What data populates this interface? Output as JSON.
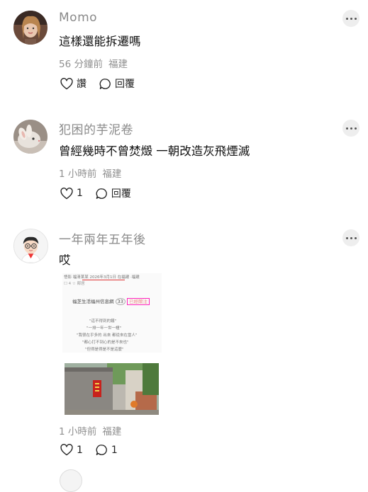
{
  "comments": [
    {
      "name": "Momo",
      "text": "這樣還能拆遷嗎",
      "time": "56 分鐘前",
      "location": "福建",
      "like_label": "讚",
      "reply_label": "回覆"
    },
    {
      "name": "犯困的芋泥卷",
      "text": "曾經幾時不曾焚燬 一朝改造灰飛煙滅",
      "time": "1 小時前",
      "location": "福建",
      "like_count": "1",
      "reply_label": "回覆"
    },
    {
      "name": "一年兩年五年後",
      "text": "哎",
      "time": "1 小時前",
      "location": "福建",
      "like_count": "1",
      "reply_count": "1"
    }
  ],
  "icons": [
    "heart-icon",
    "comment-bubble-icon",
    "more-dots-icon"
  ],
  "colors": {
    "name_gray": "#8a8a8a",
    "meta_gray": "#8f8f8f",
    "text": "#111111",
    "more_bg": "#eeeeee"
  }
}
